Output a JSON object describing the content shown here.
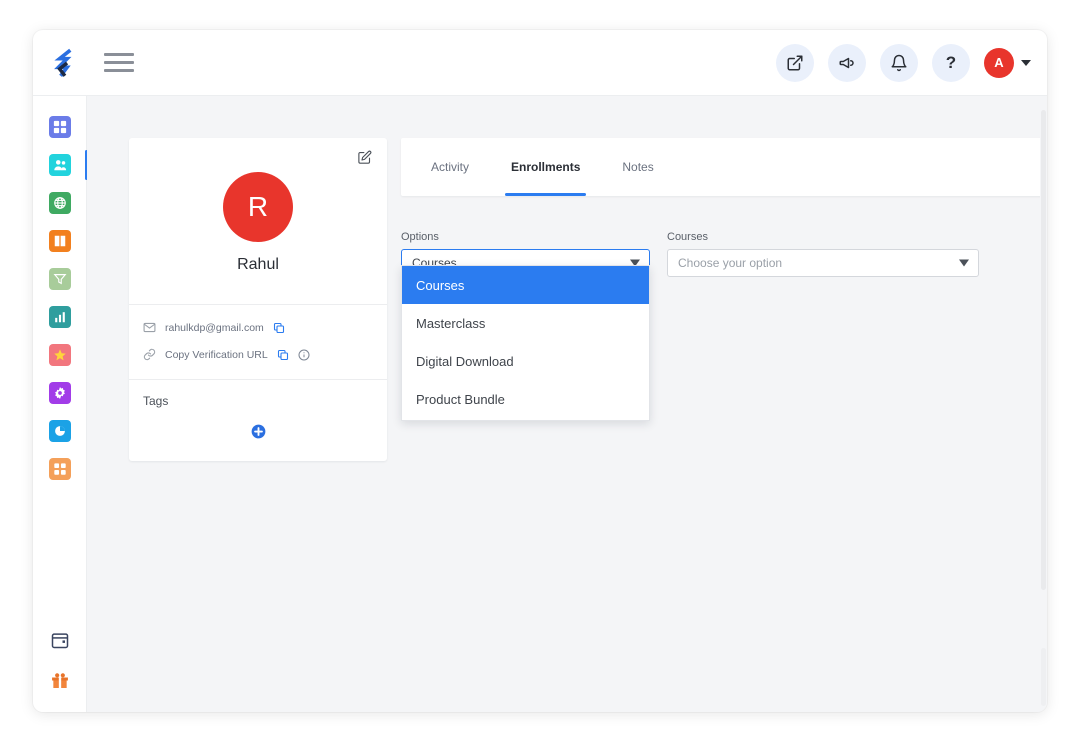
{
  "header": {
    "logo_name": "brand-logo",
    "menu_label": "menu",
    "actions": [
      {
        "name": "external-link-icon",
        "label": "Open in new tab"
      },
      {
        "name": "megaphone-icon",
        "label": "Announcements"
      },
      {
        "name": "bell-icon",
        "label": "Notifications"
      },
      {
        "name": "help-icon",
        "label": "?"
      }
    ],
    "avatar_initial": "A"
  },
  "sidebar": {
    "items": [
      {
        "name": "sidebar-item-dashboard",
        "icon": "grid-icon",
        "color": "#6b7ce8",
        "active": false
      },
      {
        "name": "sidebar-item-users",
        "icon": "users-icon",
        "color": "#22d3dd",
        "active": true
      },
      {
        "name": "sidebar-item-site",
        "icon": "globe-icon",
        "color": "#3faa62",
        "active": false
      },
      {
        "name": "sidebar-item-courses",
        "icon": "book-icon",
        "color": "#f2801f",
        "active": false
      },
      {
        "name": "sidebar-item-marketing",
        "icon": "funnel-icon",
        "color": "#a8cc9a",
        "active": false
      },
      {
        "name": "sidebar-item-reports",
        "icon": "bar-chart-icon",
        "color": "#2f9e9e",
        "active": false
      },
      {
        "name": "sidebar-item-reviews",
        "icon": "star-icon",
        "color": "#f2767e",
        "active": false
      },
      {
        "name": "sidebar-item-settings",
        "icon": "gear-icon",
        "color": "#a23ce8",
        "active": false
      },
      {
        "name": "sidebar-item-analytics",
        "icon": "pie-chart-icon",
        "color": "#1ba2e6",
        "active": false
      },
      {
        "name": "sidebar-item-apps",
        "icon": "apps-icon",
        "color": "#f4a05a",
        "active": false
      }
    ],
    "bottom_items": [
      {
        "name": "sidebar-item-calendar",
        "icon": "calendar-icon"
      },
      {
        "name": "sidebar-item-gift",
        "icon": "gift-icon"
      }
    ]
  },
  "profile": {
    "avatar_initial": "R",
    "name": "Rahul",
    "edit_label": "Edit profile",
    "email": "rahulkdp@gmail.com",
    "verification_label": "Copy Verification URL",
    "tags_label": "Tags",
    "add_tag_label": "Add tag"
  },
  "tabs": [
    {
      "label": "Activity",
      "active": false
    },
    {
      "label": "Enrollments",
      "active": true
    },
    {
      "label": "Notes",
      "active": false
    }
  ],
  "form": {
    "options": {
      "label": "Options",
      "value": "Courses",
      "open": true,
      "items": [
        {
          "label": "Courses",
          "selected": true
        },
        {
          "label": "Masterclass",
          "selected": false
        },
        {
          "label": "Digital Download",
          "selected": false
        },
        {
          "label": "Product Bundle",
          "selected": false
        }
      ]
    },
    "courses": {
      "label": "Courses",
      "placeholder": "Choose your option",
      "value": ""
    }
  },
  "colors": {
    "accent_blue": "#2b7cf0",
    "avatar_red": "#e8352c",
    "page_bg": "#f4f5f7",
    "card_bg": "#ffffff"
  }
}
